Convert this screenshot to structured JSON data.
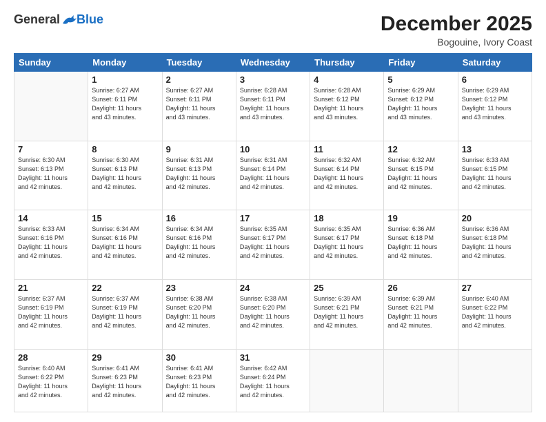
{
  "logo": {
    "general": "General",
    "blue": "Blue"
  },
  "header": {
    "month": "December 2025",
    "location": "Bogouine, Ivory Coast"
  },
  "days_of_week": [
    "Sunday",
    "Monday",
    "Tuesday",
    "Wednesday",
    "Thursday",
    "Friday",
    "Saturday"
  ],
  "weeks": [
    [
      {
        "day": "",
        "info": ""
      },
      {
        "day": "1",
        "info": "Sunrise: 6:27 AM\nSunset: 6:11 PM\nDaylight: 11 hours\nand 43 minutes."
      },
      {
        "day": "2",
        "info": "Sunrise: 6:27 AM\nSunset: 6:11 PM\nDaylight: 11 hours\nand 43 minutes."
      },
      {
        "day": "3",
        "info": "Sunrise: 6:28 AM\nSunset: 6:11 PM\nDaylight: 11 hours\nand 43 minutes."
      },
      {
        "day": "4",
        "info": "Sunrise: 6:28 AM\nSunset: 6:12 PM\nDaylight: 11 hours\nand 43 minutes."
      },
      {
        "day": "5",
        "info": "Sunrise: 6:29 AM\nSunset: 6:12 PM\nDaylight: 11 hours\nand 43 minutes."
      },
      {
        "day": "6",
        "info": "Sunrise: 6:29 AM\nSunset: 6:12 PM\nDaylight: 11 hours\nand 43 minutes."
      }
    ],
    [
      {
        "day": "7",
        "info": "Sunrise: 6:30 AM\nSunset: 6:13 PM\nDaylight: 11 hours\nand 42 minutes."
      },
      {
        "day": "8",
        "info": "Sunrise: 6:30 AM\nSunset: 6:13 PM\nDaylight: 11 hours\nand 42 minutes."
      },
      {
        "day": "9",
        "info": "Sunrise: 6:31 AM\nSunset: 6:13 PM\nDaylight: 11 hours\nand 42 minutes."
      },
      {
        "day": "10",
        "info": "Sunrise: 6:31 AM\nSunset: 6:14 PM\nDaylight: 11 hours\nand 42 minutes."
      },
      {
        "day": "11",
        "info": "Sunrise: 6:32 AM\nSunset: 6:14 PM\nDaylight: 11 hours\nand 42 minutes."
      },
      {
        "day": "12",
        "info": "Sunrise: 6:32 AM\nSunset: 6:15 PM\nDaylight: 11 hours\nand 42 minutes."
      },
      {
        "day": "13",
        "info": "Sunrise: 6:33 AM\nSunset: 6:15 PM\nDaylight: 11 hours\nand 42 minutes."
      }
    ],
    [
      {
        "day": "14",
        "info": "Sunrise: 6:33 AM\nSunset: 6:16 PM\nDaylight: 11 hours\nand 42 minutes."
      },
      {
        "day": "15",
        "info": "Sunrise: 6:34 AM\nSunset: 6:16 PM\nDaylight: 11 hours\nand 42 minutes."
      },
      {
        "day": "16",
        "info": "Sunrise: 6:34 AM\nSunset: 6:16 PM\nDaylight: 11 hours\nand 42 minutes."
      },
      {
        "day": "17",
        "info": "Sunrise: 6:35 AM\nSunset: 6:17 PM\nDaylight: 11 hours\nand 42 minutes."
      },
      {
        "day": "18",
        "info": "Sunrise: 6:35 AM\nSunset: 6:17 PM\nDaylight: 11 hours\nand 42 minutes."
      },
      {
        "day": "19",
        "info": "Sunrise: 6:36 AM\nSunset: 6:18 PM\nDaylight: 11 hours\nand 42 minutes."
      },
      {
        "day": "20",
        "info": "Sunrise: 6:36 AM\nSunset: 6:18 PM\nDaylight: 11 hours\nand 42 minutes."
      }
    ],
    [
      {
        "day": "21",
        "info": "Sunrise: 6:37 AM\nSunset: 6:19 PM\nDaylight: 11 hours\nand 42 minutes."
      },
      {
        "day": "22",
        "info": "Sunrise: 6:37 AM\nSunset: 6:19 PM\nDaylight: 11 hours\nand 42 minutes."
      },
      {
        "day": "23",
        "info": "Sunrise: 6:38 AM\nSunset: 6:20 PM\nDaylight: 11 hours\nand 42 minutes."
      },
      {
        "day": "24",
        "info": "Sunrise: 6:38 AM\nSunset: 6:20 PM\nDaylight: 11 hours\nand 42 minutes."
      },
      {
        "day": "25",
        "info": "Sunrise: 6:39 AM\nSunset: 6:21 PM\nDaylight: 11 hours\nand 42 minutes."
      },
      {
        "day": "26",
        "info": "Sunrise: 6:39 AM\nSunset: 6:21 PM\nDaylight: 11 hours\nand 42 minutes."
      },
      {
        "day": "27",
        "info": "Sunrise: 6:40 AM\nSunset: 6:22 PM\nDaylight: 11 hours\nand 42 minutes."
      }
    ],
    [
      {
        "day": "28",
        "info": "Sunrise: 6:40 AM\nSunset: 6:22 PM\nDaylight: 11 hours\nand 42 minutes."
      },
      {
        "day": "29",
        "info": "Sunrise: 6:41 AM\nSunset: 6:23 PM\nDaylight: 11 hours\nand 42 minutes."
      },
      {
        "day": "30",
        "info": "Sunrise: 6:41 AM\nSunset: 6:23 PM\nDaylight: 11 hours\nand 42 minutes."
      },
      {
        "day": "31",
        "info": "Sunrise: 6:42 AM\nSunset: 6:24 PM\nDaylight: 11 hours\nand 42 minutes."
      },
      {
        "day": "",
        "info": ""
      },
      {
        "day": "",
        "info": ""
      },
      {
        "day": "",
        "info": ""
      }
    ]
  ]
}
